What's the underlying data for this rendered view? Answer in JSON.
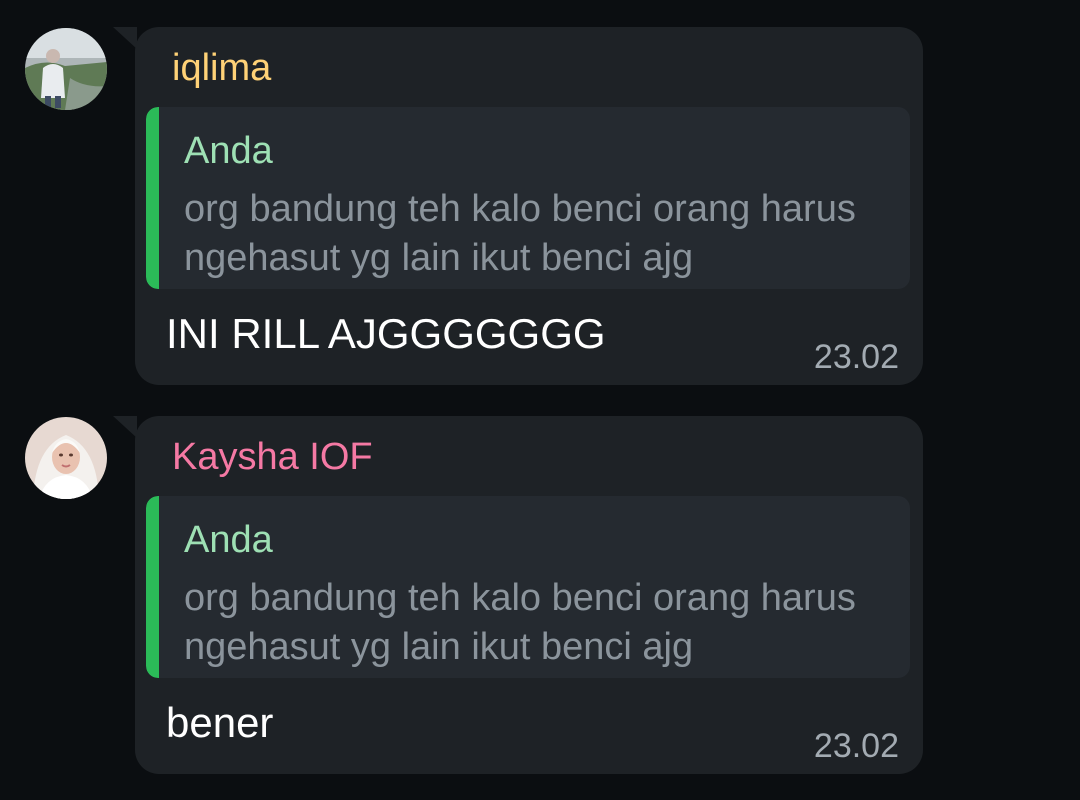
{
  "colors": {
    "background": "#0b0e11",
    "bubble": "#1e2226",
    "reply_background": "#252a30",
    "reply_bar": "#2bbb58",
    "reply_author": "#9ee0b4",
    "reply_text": "#8b949c",
    "message_text": "#ffffff",
    "timestamp": "#a3abb2"
  },
  "messages": [
    {
      "sender": "iqlima",
      "sender_color": "#ffd277",
      "avatar_icon": "user-photo-avatar",
      "reply": {
        "author": "Anda",
        "text": "org bandung teh kalo benci orang harus ngehasut yg lain ikut benci ajg"
      },
      "text": "INI RILL AJGGGGGGG",
      "time": "23.02"
    },
    {
      "sender": "Kaysha IOF",
      "sender_color": "#f579a4",
      "avatar_icon": "user-photo-avatar",
      "reply": {
        "author": "Anda",
        "text": "org bandung teh kalo benci orang harus ngehasut yg lain ikut benci ajg"
      },
      "text": "bener",
      "time": "23.02"
    }
  ]
}
